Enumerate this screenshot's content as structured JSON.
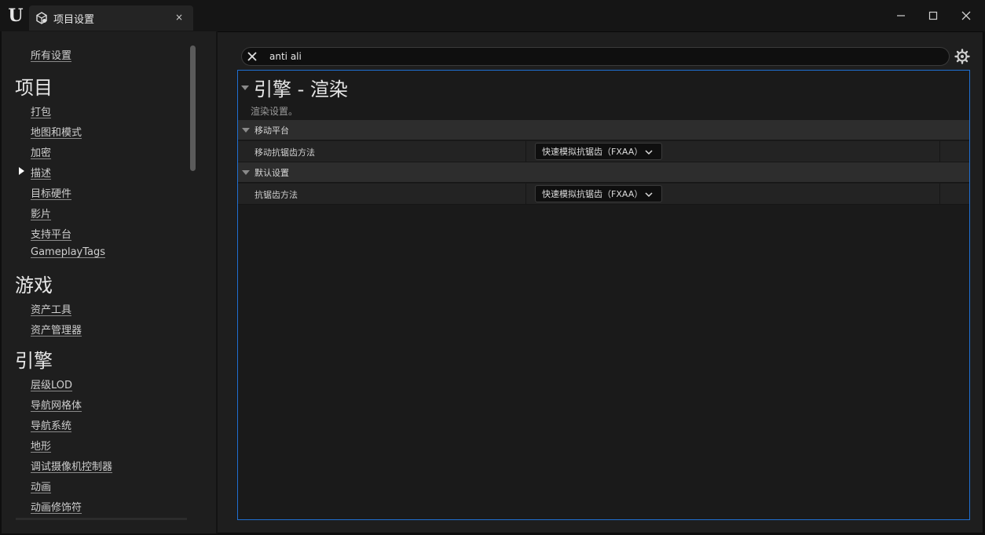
{
  "window": {
    "tab_title": "项目设置",
    "tab_close": "×"
  },
  "nav": {
    "all_settings": "所有设置",
    "sections": [
      {
        "title": "项目",
        "items": [
          "打包",
          "地图和模式",
          "加密",
          "描述",
          "目标硬件",
          "影片",
          "支持平台",
          "GameplayTags"
        ]
      },
      {
        "title": "游戏",
        "items": [
          "资产工具",
          "资产管理器"
        ]
      },
      {
        "title": "引擎",
        "items": [
          "层级LOD",
          "导航网格体",
          "导航系统",
          "地形",
          "调试摄像机控制器",
          "动画",
          "动画修饰符"
        ]
      }
    ],
    "selected_item": "描述"
  },
  "search": {
    "value": "anti ali"
  },
  "details": {
    "category_title": "引擎 - 渲染",
    "category_description": "渲染设置。",
    "groups": [
      {
        "label": "移动平台",
        "properties": [
          {
            "label": "移动抗锯齿方法",
            "value": "快速模拟抗锯齿（FXAA）"
          }
        ]
      },
      {
        "label": "默认设置",
        "properties": [
          {
            "label": "抗锯齿方法",
            "value": "快速模拟抗锯齿（FXAA）"
          }
        ]
      }
    ]
  },
  "colors": {
    "focus_border": "#1f6fd1",
    "panel_bg": "#1a1a1a",
    "group_bg": "#2d2d2d"
  }
}
